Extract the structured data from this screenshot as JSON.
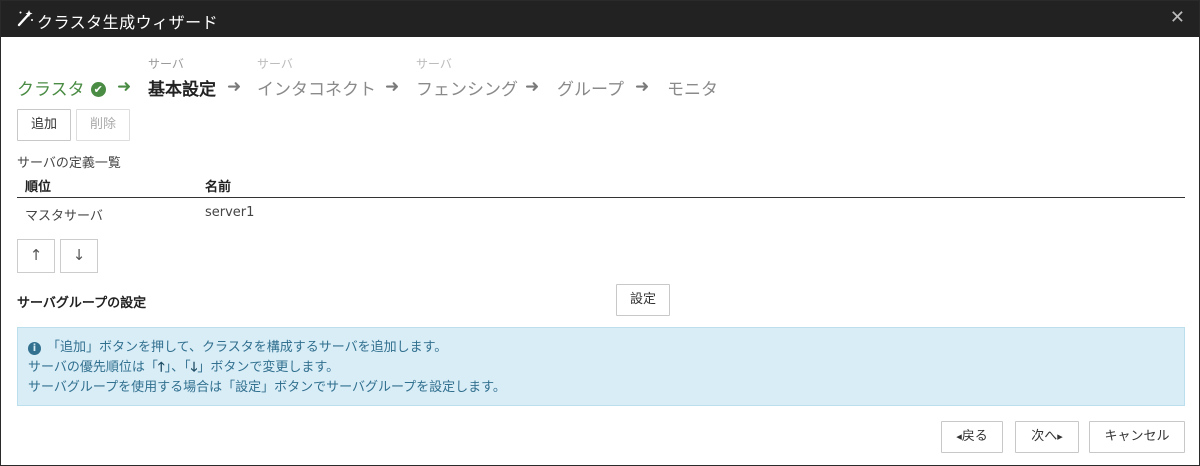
{
  "window": {
    "title": "クラスタ生成ウィザード",
    "title_icon": "wand-icon",
    "close_icon": "close-icon",
    "close_glyph": "✕"
  },
  "steps": [
    {
      "sub": "",
      "label": "クラスタ",
      "state": "done"
    },
    {
      "sub": "サーバ",
      "label": "基本設定",
      "state": "current"
    },
    {
      "sub": "サーバ",
      "label": "インタコネクト",
      "state": "todo"
    },
    {
      "sub": "サーバ",
      "label": "フェンシング",
      "state": "todo"
    },
    {
      "sub": "",
      "label": "グループ",
      "state": "todo"
    },
    {
      "sub": "",
      "label": "モニタ",
      "state": "todo"
    }
  ],
  "step_arrow": "➜",
  "check_glyph": "✔",
  "toolbar": {
    "add_label": "追加",
    "delete_label": "削除"
  },
  "server_list": {
    "caption": "サーバの定義一覧",
    "columns": [
      "順位",
      "名前"
    ],
    "rows": [
      {
        "order": "マスタサーバ",
        "name": "server1"
      }
    ]
  },
  "move": {
    "up_glyph": "↑",
    "down_glyph": "↓"
  },
  "server_group": {
    "label": "サーバグループの設定",
    "button_label": "設定"
  },
  "info": {
    "icon": "info-icon",
    "icon_glyph": "i",
    "lines": [
      "「追加」ボタンを押して、クラスタを構成するサーバを追加します。",
      "サーバの優先順位は「",
      "」、「",
      "」ボタンで変更します。",
      "サーバグループを使用する場合は「設定」ボタンでサーバグループを設定します。"
    ],
    "up_glyph": "🡑",
    "down_glyph": "🡓"
  },
  "footer": {
    "back_label": "戻る",
    "next_label": "次へ",
    "cancel_label": "キャンセル",
    "back_glyph": "◂",
    "next_glyph": "▸"
  },
  "colors": {
    "titlebar": "#222222",
    "done": "#4a8c44",
    "info_bg": "#d9edf7",
    "info_text": "#31708f"
  }
}
